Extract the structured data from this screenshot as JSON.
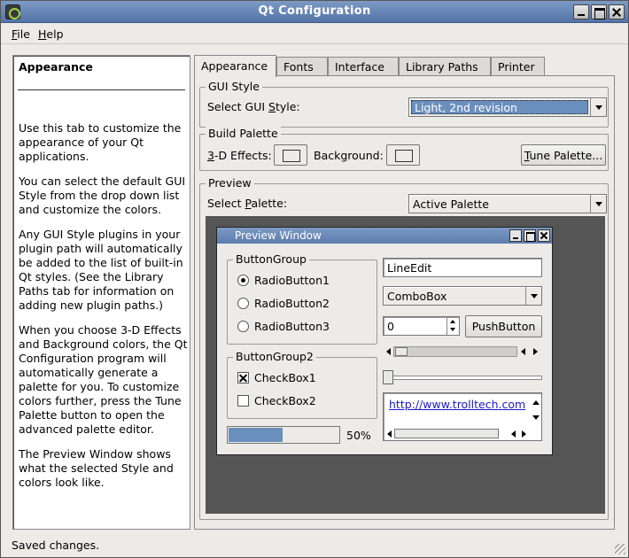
{
  "window": {
    "title": "Qt Configuration",
    "accent": "#5b7cad"
  },
  "menu": {
    "file": "F",
    "file_rest": "ile",
    "help": "H",
    "help_rest": "elp"
  },
  "help": {
    "title": "Appearance",
    "paragraphs": [
      "Use this tab to customize the appearance of your Qt applications.",
      "You can select the default GUI Style from the drop down list and customize the colors.",
      "Any GUI Style plugins in your plugin path will automatically be added to the list of built-in Qt styles. (See the Library Paths tab for information on adding new plugin paths.)",
      "When you choose 3-D Effects and Background colors, the Qt Configuration program will automatically generate a palette for you. To customize colors further, press the Tune Palette button to open the advanced palette editor.",
      "The Preview Window shows what the selected Style and colors look like."
    ]
  },
  "tabs": [
    "Appearance",
    "Fonts",
    "Interface",
    "Library Paths",
    "Printer"
  ],
  "gui_style": {
    "group_title": "GUI Style",
    "label_pre": "Select GUI ",
    "label_u": "S",
    "label_post": "tyle:",
    "value": "Light, 2nd revision"
  },
  "build_palette": {
    "group_title": "Build Palette",
    "effects_u": "3",
    "effects_rest": "-D Effects:",
    "background_pre": "Back",
    "background_u": "g",
    "background_post": "round:",
    "tune_u": "T",
    "tune_rest": "une Palette..."
  },
  "preview": {
    "group_title": "Preview",
    "label_pre": "Select ",
    "label_u": "P",
    "label_post": "alette:",
    "value": "Active Palette",
    "window_title": "Preview Window",
    "button_group_1": "ButtonGroup",
    "radio_buttons": [
      "RadioButton1",
      "RadioButton2",
      "RadioButton3"
    ],
    "button_group_2": "ButtonGroup2",
    "checkboxes": [
      "CheckBox1",
      "CheckBox2"
    ],
    "line_edit": "LineEdit",
    "combo_box": "ComboBox",
    "spin_value": "0",
    "push_button": "PushButton",
    "link": "http://www.trolltech.com",
    "progress": {
      "value": 50,
      "label": "50%"
    }
  },
  "status": "Saved changes."
}
